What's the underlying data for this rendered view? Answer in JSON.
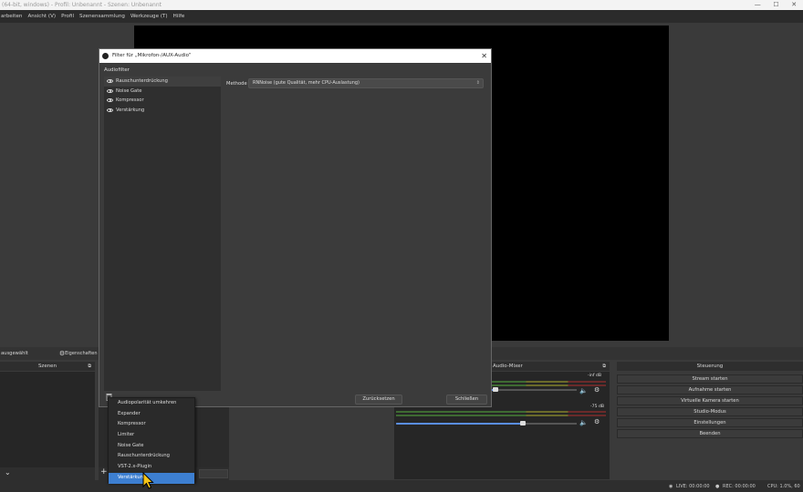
{
  "window": {
    "title": "(64-bit, windows) - Profil: Unbenannt - Szenen: Unbenannt",
    "controls": [
      "—",
      "☐",
      "✕"
    ]
  },
  "menu": [
    "arbeiten",
    "Ansicht (V)",
    "Profil",
    "Szenensammlung",
    "Werkzeuge (T)",
    "Hilfe"
  ],
  "dock": {
    "source_status": "ausgewählt",
    "properties_label": "Eigenschaften"
  },
  "scenes": {
    "header": "Szenen"
  },
  "mixer": {
    "header": "Audio-Mixer",
    "track1_db": "-inf dB",
    "track2_db": "-75 dB"
  },
  "controls": {
    "header": "Steuerung",
    "buttons": [
      "Stream starten",
      "Aufnahme starten",
      "Virtuelle Kamera starten",
      "Studio-Modus",
      "Einstellungen",
      "Beenden"
    ]
  },
  "status": {
    "live": "LIVE: 00:00:00",
    "rec": "REC: 00:00:00",
    "cpu": "CPU: 1.0%, 60"
  },
  "dialog": {
    "title": "Filter für „Mikrofon-/AUX-Audio“",
    "section_label": "Audiofilter",
    "filters": [
      "Rauschunterdrückung",
      "Noise Gate",
      "Kompressor",
      "Verstärkung"
    ],
    "method_label": "Methode",
    "method_value": "RNNoise (gute Qualität, mehr CPU-Auslastung)",
    "reset_label": "Zurücksetzen",
    "close_label": "Schließen"
  },
  "dropdown": {
    "items": [
      "Audiopolarität umkehren",
      "Expander",
      "Kompressor",
      "Limiter",
      "Noise Gate",
      "Rauschunterdrückung",
      "VST-2.x-Plugin",
      "Verstärkung"
    ],
    "hovered_index": 7
  },
  "colors": {
    "accent": "#3d7fd1",
    "preview_bg": "#000000",
    "slider": "#5a8ee6"
  }
}
